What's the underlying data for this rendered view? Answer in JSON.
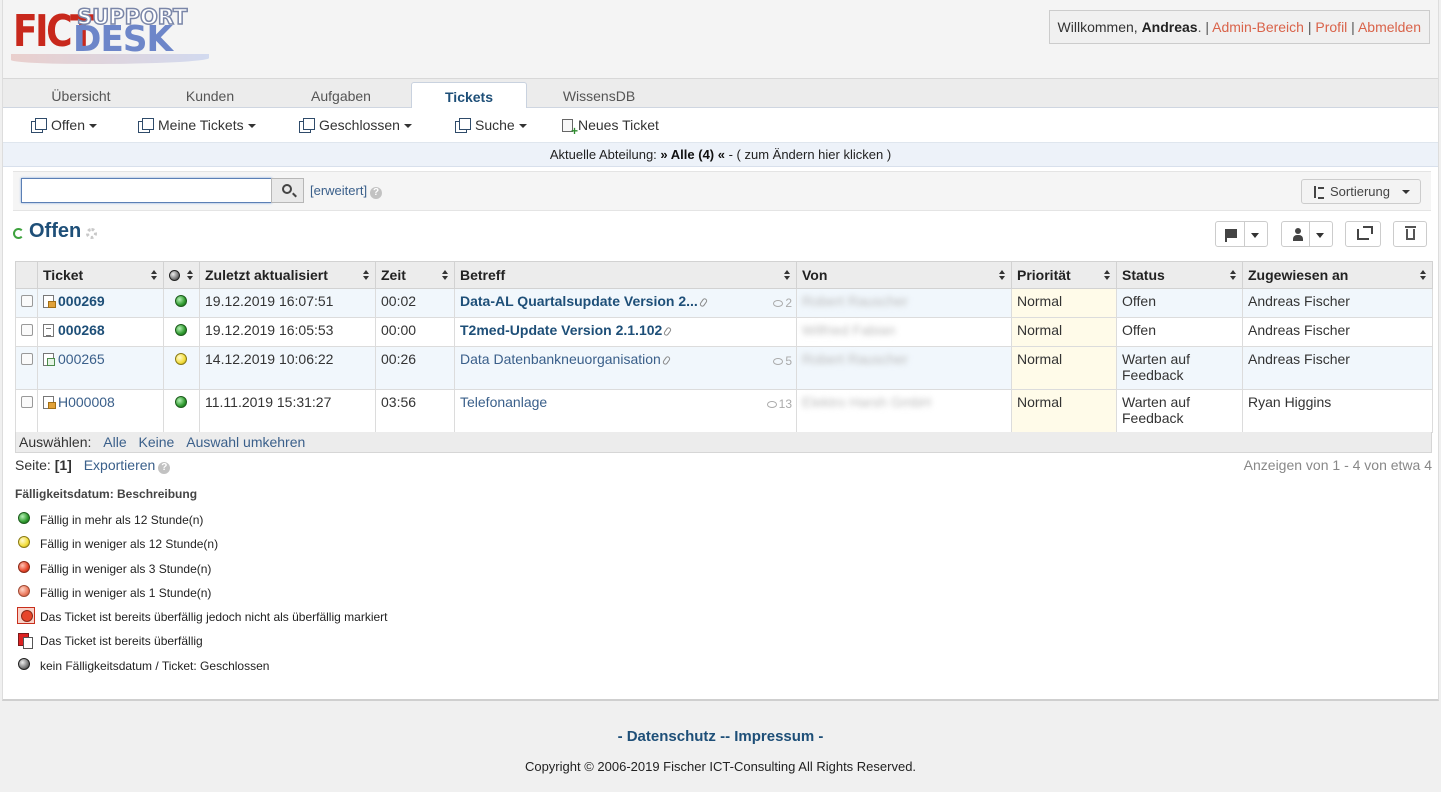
{
  "header": {
    "logo_fict": "FICT",
    "logo_support": "SUPPORT",
    "logo_desk": "DESK",
    "welcome_prefix": "Willkommen,",
    "user": "Andreas",
    "admin_label": "Admin-Bereich",
    "profile_label": "Profil",
    "logout_label": "Abmelden"
  },
  "tabs": [
    {
      "label": "Übersicht",
      "active": false
    },
    {
      "label": "Kunden",
      "active": false
    },
    {
      "label": "Aufgaben",
      "active": false
    },
    {
      "label": "Tickets",
      "active": true
    },
    {
      "label": "WissensDB",
      "active": false
    }
  ],
  "subnav": {
    "open": "Offen",
    "my_tickets": "Meine Tickets",
    "closed": "Geschlossen",
    "search": "Suche",
    "new_ticket": "Neues Ticket"
  },
  "department": {
    "label": "Aktuelle Abteilung:",
    "value": "» Alle (4) «",
    "change_hint": "-  ( zum Ändern hier klicken )"
  },
  "search": {
    "value": "",
    "advanced": "[erweitert]",
    "sort_label": "Sortierung"
  },
  "list": {
    "title": "Offen"
  },
  "table": {
    "headers": {
      "ticket": "Ticket",
      "updated": "Zuletzt aktualisiert",
      "time": "Zeit",
      "subject": "Betreff",
      "from": "Von",
      "priority": "Priorität",
      "status": "Status",
      "assigned": "Zugewiesen an"
    },
    "rows": [
      {
        "ticket": "000269",
        "due": "green",
        "updated": "19.12.2019 16:07:51",
        "time": "00:02",
        "subject": "Data-AL Quartalsupdate Version 2...",
        "comments": "2",
        "from": "Robert Rauscher",
        "priority": "Normal",
        "status": "Offen",
        "assigned": "Andreas Fischer"
      },
      {
        "ticket": "000268",
        "due": "green",
        "updated": "19.12.2019 16:05:53",
        "time": "00:00",
        "subject": "T2med-Update Version 2.1.102",
        "comments": "",
        "from": "Wilfried Fabian",
        "priority": "Normal",
        "status": "Offen",
        "assigned": "Andreas Fischer"
      },
      {
        "ticket": "000265",
        "due": "yellow",
        "updated": "14.12.2019 10:06:22",
        "time": "00:26",
        "subject": "Data Datenbankneuorganisation",
        "comments": "5",
        "from": "Robert Rauscher",
        "priority": "Normal",
        "status": "Warten auf Feedback",
        "assigned": "Andreas Fischer"
      },
      {
        "ticket": "H000008",
        "due": "green",
        "updated": "11.11.2019 15:31:27",
        "time": "03:56",
        "subject": "Telefonanlage",
        "comments": "13",
        "from": "Elektro Harsh GmbH",
        "priority": "Normal",
        "status": "Warten auf Feedback",
        "assigned": "Ryan Higgins"
      }
    ]
  },
  "selection": {
    "label": "Auswählen:",
    "all": "Alle",
    "none": "Keine",
    "invert": "Auswahl umkehren"
  },
  "paging": {
    "label": "Seite:",
    "current": "[1]",
    "export": "Exportieren",
    "summary": "Anzeigen von  1 - 4 von etwa 4"
  },
  "legend": {
    "title": "Fälligkeitsdatum: Beschreibung",
    "items": [
      "Fällig in mehr als 12 Stunde(n)",
      "Fällig in weniger als 12 Stunde(n)",
      "Fällig in weniger als 3 Stunde(n)",
      "Fällig in weniger als 1 Stunde(n)",
      "Das Ticket ist bereits überfällig jedoch nicht als überfällig markiert",
      "Das Ticket ist bereits überfällig",
      "kein Fälligkeitsdatum / Ticket: Geschlossen"
    ]
  },
  "footer": {
    "links": "- Datenschutz -- Impressum -",
    "copyright": "Copyright © 2006-2019 Fischer ICT-Consulting All Rights Reserved."
  }
}
